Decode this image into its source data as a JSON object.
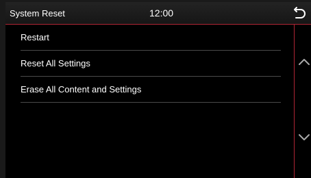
{
  "header": {
    "title": "System Reset",
    "time": "12:00",
    "back_icon": "back-arrow-icon"
  },
  "menu": {
    "items": [
      {
        "label": "Restart"
      },
      {
        "label": "Reset All Settings"
      },
      {
        "label": "Erase All Content and Settings"
      }
    ]
  },
  "scroll": {
    "up_icon": "chevron-up-icon",
    "down_icon": "chevron-down-icon"
  },
  "colors": {
    "background": "#000000",
    "accent": "#b02535",
    "text": "#ffffff",
    "divider": "#4a4a4a",
    "icon": "#aaaaaa"
  }
}
